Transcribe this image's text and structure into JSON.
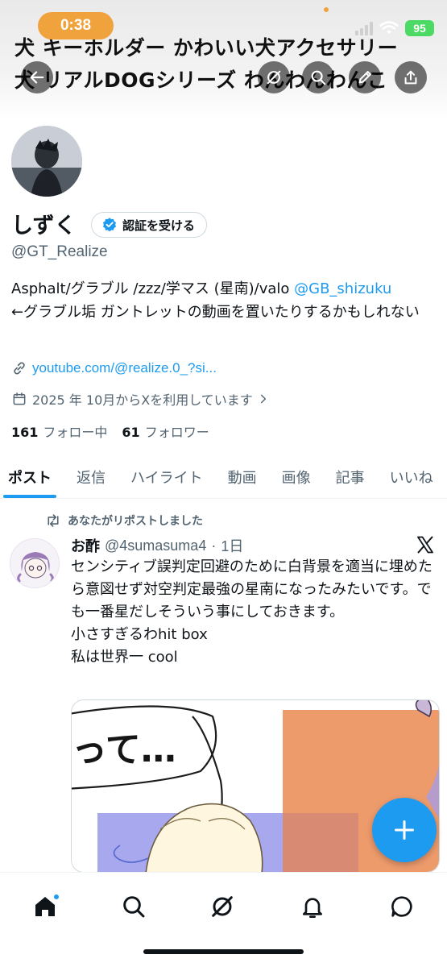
{
  "status_bar": {
    "time": "0:38",
    "battery": "95"
  },
  "header": {
    "banner_line1": "犬 キーホルダー かわいい犬アクセサリー",
    "banner_line2": "犬 リアルDOGシリーズ わんわんわんこ"
  },
  "profile": {
    "name": "しずく",
    "verify_label": "認証を受ける",
    "handle": "@GT_Realize",
    "bio_prefix": "Asphalt/グラブル /zzz/学マス (星南)/valo ",
    "bio_mention": "@GB_shizuku",
    "bio_suffix": "←グラブル垢 ガントレットの動画を置いたりするかもしれない",
    "link": "youtube.com/@realize.0_?si...",
    "joined": "2025 年 10月からXを利用しています",
    "following_count": "161",
    "following_label": "フォロー中",
    "followers_count": "61",
    "followers_label": "フォロワー"
  },
  "tabs": [
    "ポスト",
    "返信",
    "ハイライト",
    "動画",
    "画像",
    "記事",
    "いいね"
  ],
  "post": {
    "repost_label": "あなたがリポストしました",
    "author": "お酢",
    "handle": "@4sumasuma4",
    "time": "1日",
    "lines": [
      "センシティブ誤判定回避のために白背景を適当に埋めたら意図せず対空判定最強の星南になったみたいです。でも一番星だしそういう事にしておきます。",
      "小さすぎるわhit box",
      "私は世界一 cool"
    ],
    "media_text": "って…"
  },
  "colors": {
    "accent": "#1d9bf0",
    "time_pill": "#f0a23c",
    "battery": "#4cd964"
  },
  "icons": {
    "nav": [
      "home-icon",
      "search-icon",
      "grok-icon",
      "notifications-icon",
      "messages-icon"
    ]
  }
}
